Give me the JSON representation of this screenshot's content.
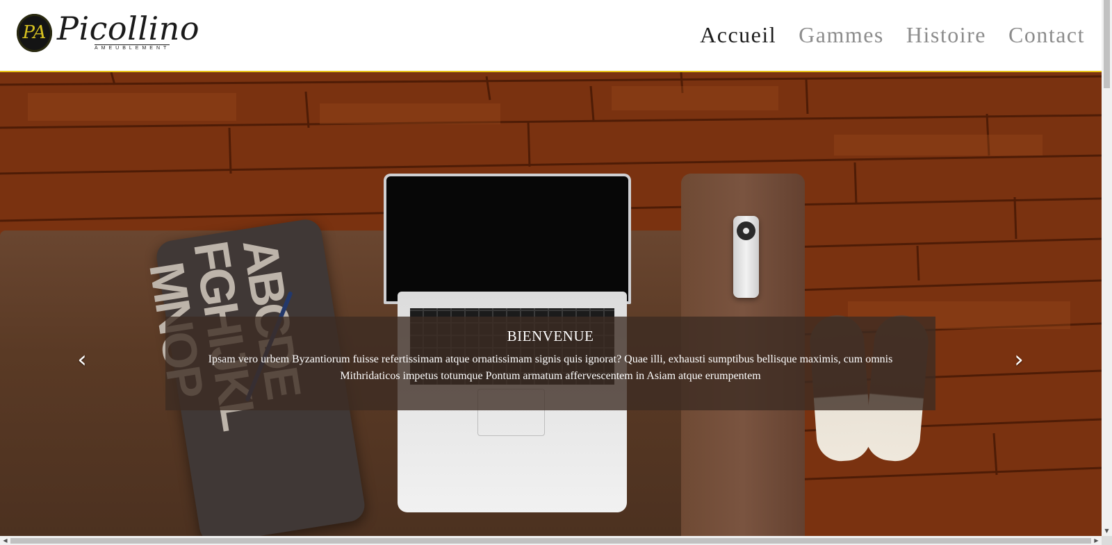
{
  "brand": {
    "name": "Picollino",
    "subtitle": "AMEUBLEMENT",
    "monogram": "PA"
  },
  "nav": {
    "items": [
      {
        "label": "Accueil",
        "active": true
      },
      {
        "label": "Gammes",
        "active": false
      },
      {
        "label": "Histoire",
        "active": false
      },
      {
        "label": "Contact",
        "active": false
      }
    ]
  },
  "hero": {
    "caption_title": "BIENVENUE",
    "caption_text": "Ipsam vero urbem Byzantiorum fuisse refertissimam atque ornatissimam signis quis ignorat? Quae illi, exhausti sumptibus bellisque maximis, cum omnis Mithridaticos impetus totumque Pontum armatum affervescentem in Asiam atque erumpentem",
    "prev_icon": "chevron-left",
    "next_icon": "chevron-right"
  },
  "colors": {
    "accent": "#e8c21a",
    "nav_active": "#1c1c1c",
    "nav_inactive": "#8c8c8c"
  }
}
